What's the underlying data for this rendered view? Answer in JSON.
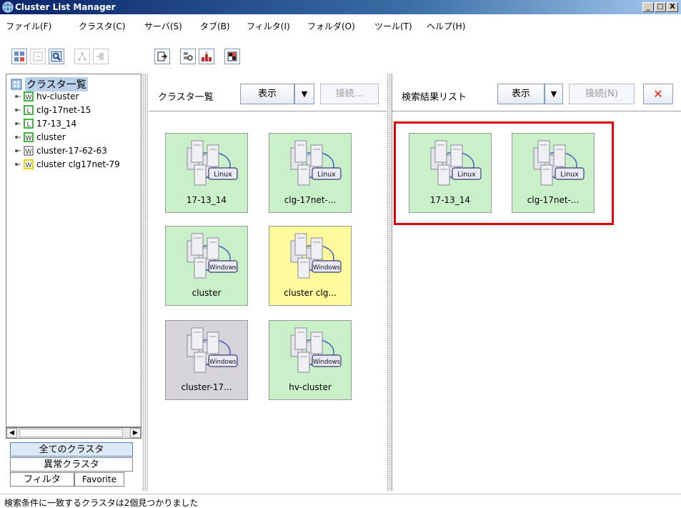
{
  "window": {
    "title": "Cluster List Manager",
    "controls": [
      "_",
      "□",
      "X"
    ]
  },
  "menu": [
    "ファイル(F)",
    "クラスタ(C)",
    "サーバ(S)",
    "タブ(B)",
    "フィルタ(I)",
    "フォルダ(O)",
    "ツール(T)",
    "ヘルプ(H)"
  ],
  "tree": {
    "root": "クラスタ一覧",
    "items": [
      {
        "label": "hv-cluster",
        "icon": "windows-cluster-icon"
      },
      {
        "label": "clg-17net-15",
        "icon": "linux-cluster-icon"
      },
      {
        "label": "17-13_14",
        "icon": "linux-cluster-icon"
      },
      {
        "label": "cluster",
        "icon": "windows-cluster-icon"
      },
      {
        "label": "cluster-17-62-63",
        "icon": "windows-cluster-icon"
      },
      {
        "label": "cluster clg17net-79",
        "icon": "windows-cluster-icon"
      }
    ]
  },
  "left_tabs": {
    "all": "全てのクラスタ",
    "abnormal": "異常クラスタ",
    "filter": "フィルタ",
    "favorite": "Favorite"
  },
  "cluster_list": {
    "title": "クラスタ一覧",
    "show_label": "表示",
    "dropdown_arrow": "▼",
    "connect_label": "接続...",
    "tiles": [
      {
        "label": "17-13_14",
        "os": "Linux",
        "status": "normal",
        "color": "#c9f0c9"
      },
      {
        "label": "clg-17net-...",
        "os": "Linux",
        "status": "normal",
        "color": "#c9f0c9"
      },
      {
        "label": "cluster",
        "os": "Windows",
        "status": "normal",
        "color": "#c9f0c9"
      },
      {
        "label": "cluster clg...",
        "os": "Windows",
        "status": "warning",
        "color": "#fdfa9c"
      },
      {
        "label": "cluster-17...",
        "os": "Windows",
        "status": "unknown",
        "color": "#d6d4d8"
      },
      {
        "label": "hv-cluster",
        "os": "Windows",
        "status": "normal",
        "color": "#c9f0c9"
      }
    ]
  },
  "search_results": {
    "title": "検索結果リスト",
    "show_label": "表示",
    "dropdown_arrow": "▼",
    "connect_label": "接続(N)",
    "close_symbol": "✕",
    "tiles": [
      {
        "label": "17-13_14",
        "os": "Linux",
        "status": "normal",
        "color": "#c9f0c9"
      },
      {
        "label": "clg-17net-...",
        "os": "Linux",
        "status": "normal",
        "color": "#c9f0c9"
      }
    ],
    "highlight_color": "#e00000"
  },
  "status": {
    "message": "検索条件に一致するクラスタは2個見つかりました"
  }
}
